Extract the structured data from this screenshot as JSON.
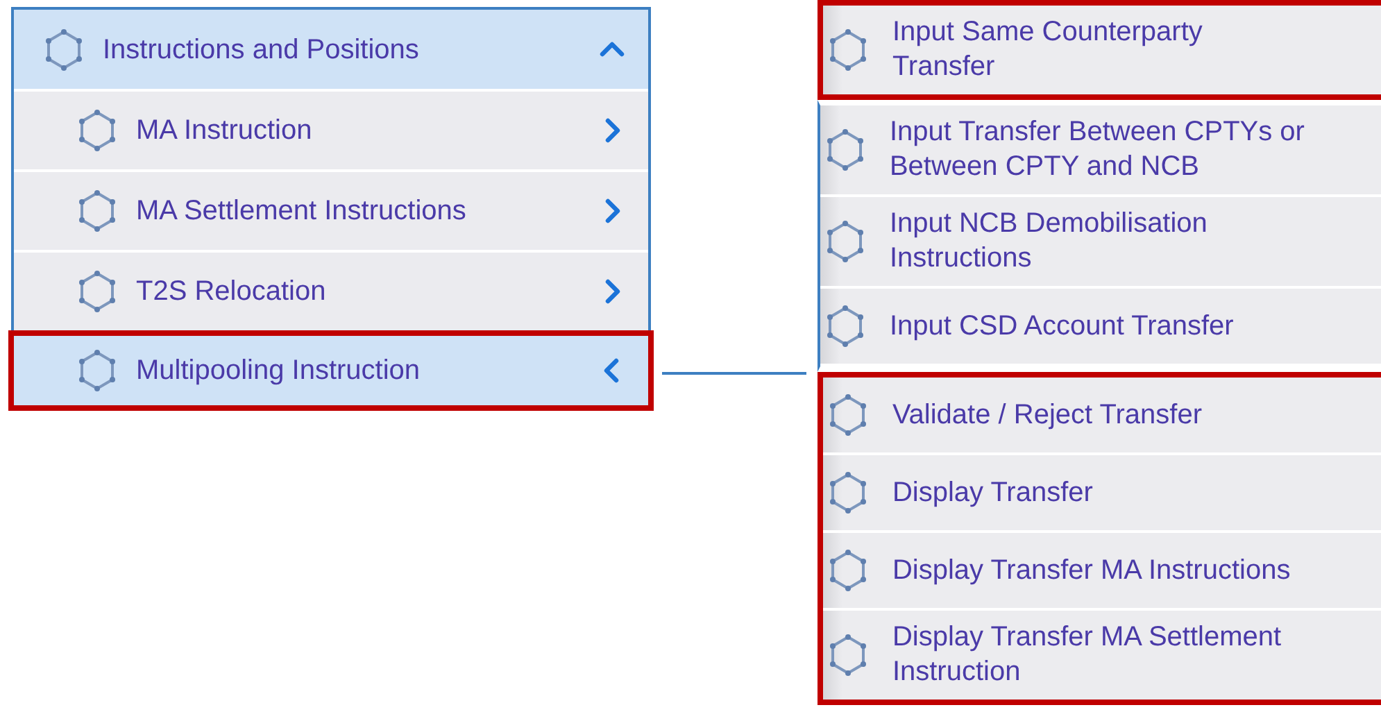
{
  "menu": {
    "header": {
      "label": "Instructions and Positions",
      "expanded": true
    },
    "items": [
      {
        "label": "MA Instruction",
        "expanded": false,
        "highlighted": false
      },
      {
        "label": "MA Settlement Instructions",
        "expanded": false,
        "highlighted": false
      },
      {
        "label": "T2S Relocation",
        "expanded": false,
        "highlighted": false
      },
      {
        "label": "Multipooling Instruction",
        "expanded": true,
        "highlighted": true
      }
    ]
  },
  "submenu": {
    "groups": [
      {
        "highlighted": true,
        "items": [
          {
            "label": "Input Same Counterparty Transfer"
          }
        ]
      },
      {
        "highlighted": false,
        "items": [
          {
            "label": "Input Transfer Between CPTYs or Between CPTY and NCB"
          },
          {
            "label": "Input NCB Demobilisation Instructions"
          },
          {
            "label": "Input CSD Account Transfer"
          }
        ]
      },
      {
        "highlighted": true,
        "items": [
          {
            "label": "Validate / Reject Transfer"
          },
          {
            "label": "Display Transfer"
          },
          {
            "label": "Display Transfer MA Instructions"
          },
          {
            "label": "Display Transfer MA Settlement Instruction"
          }
        ]
      }
    ]
  }
}
